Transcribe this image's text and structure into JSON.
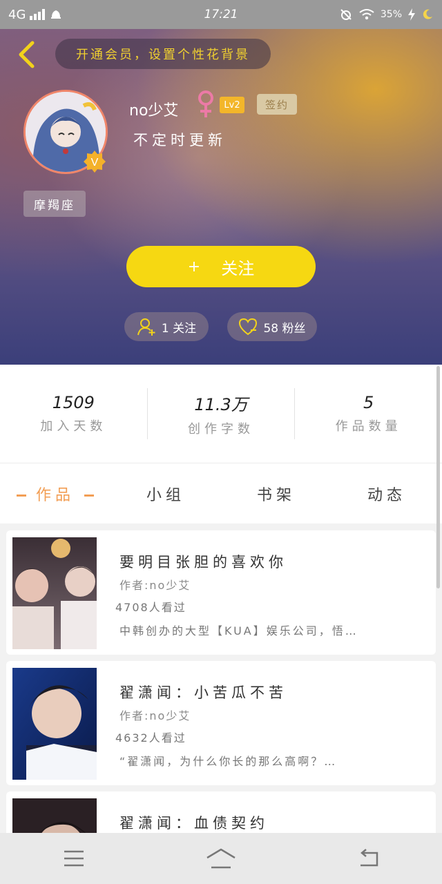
{
  "status_bar": {
    "network": "4G",
    "time": "17:21",
    "battery": "35%"
  },
  "header": {
    "background_tip": "开通会员，设置个性花背景",
    "username": "no少艾",
    "level": "Lv2",
    "signed_badge": "签约",
    "bio": "不定时更新",
    "zodiac": "摩羯座",
    "follow_button": "关注",
    "following_label": "1 关注",
    "fans_label": "58 粉丝"
  },
  "stats": [
    {
      "value": "1509",
      "label": "加入天数"
    },
    {
      "value": "11.3万",
      "label": "创作字数"
    },
    {
      "value": "5",
      "label": "作品数量"
    }
  ],
  "tabs": [
    {
      "label": "作品",
      "active": true
    },
    {
      "label": "小组",
      "active": false
    },
    {
      "label": "书架",
      "active": false
    },
    {
      "label": "动态",
      "active": false
    }
  ],
  "works": [
    {
      "title": "要明目张胆的喜欢你",
      "author": "作者:no少艾",
      "views": "4708人看过",
      "description": "中韩创办的大型【KUA】娱乐公司，悟…"
    },
    {
      "title": "翟潇闻：小苦瓜不苦",
      "author": "作者:no少艾",
      "views": "4632人看过",
      "description": "“翟潇闻，为什么你长的那么高啊？…"
    },
    {
      "title": "翟潇闻：血债契约",
      "author": "",
      "views": "",
      "description": ""
    }
  ],
  "colors": {
    "accent_yellow": "#f6d812",
    "tab_active": "#f29e54",
    "level_badge": "#f3b62a",
    "gender_icon": "#ec7aa6"
  },
  "icons": {
    "back": "chevron-left-icon",
    "gender": "female-icon",
    "verified": "v-badge-icon",
    "following": "add-user-icon",
    "fans": "heart-icon",
    "nav_menu": "menu-icon",
    "nav_home": "home-icon",
    "nav_back": "back-icon"
  }
}
